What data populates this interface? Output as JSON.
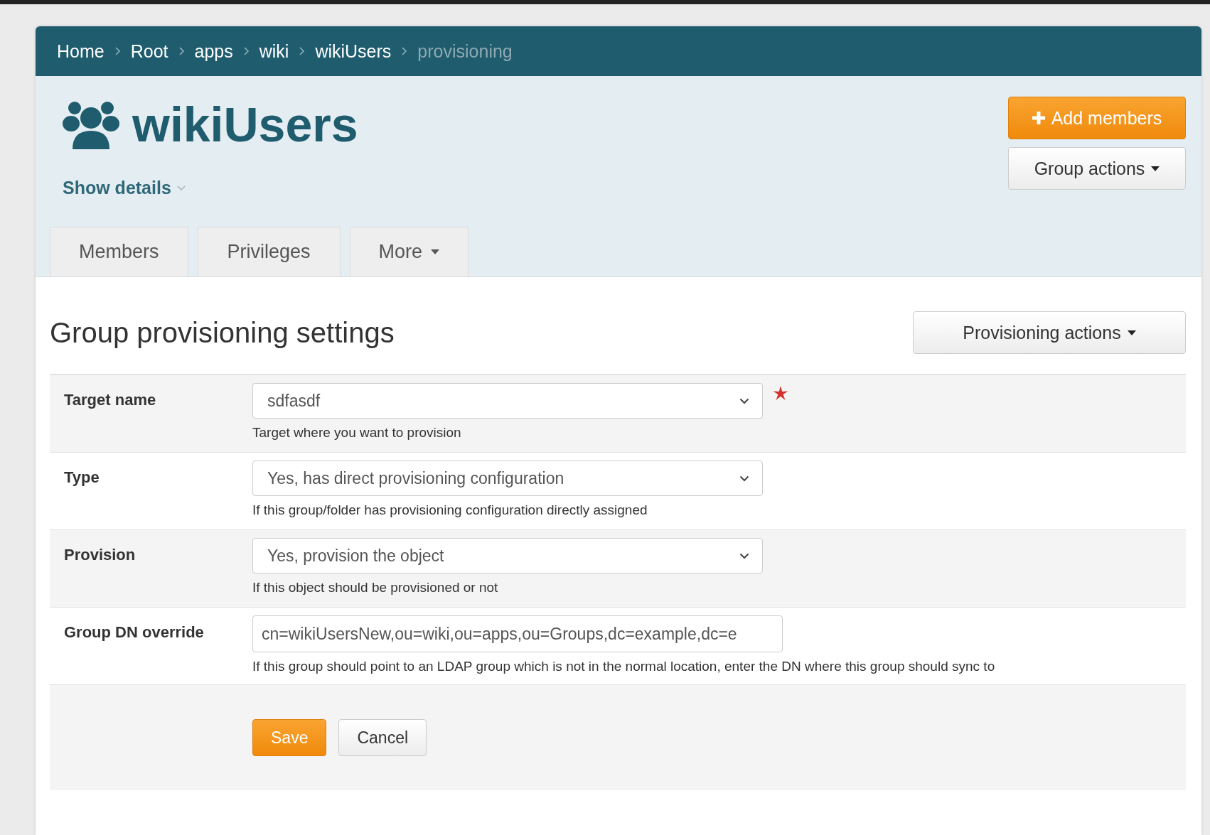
{
  "breadcrumb": [
    {
      "label": "Home",
      "current": false
    },
    {
      "label": "Root",
      "current": false
    },
    {
      "label": "apps",
      "current": false
    },
    {
      "label": "wiki",
      "current": false
    },
    {
      "label": "wikiUsers",
      "current": false
    },
    {
      "label": "provisioning",
      "current": true
    }
  ],
  "group": {
    "title": "wikiUsers",
    "details_toggle": "Show details"
  },
  "header_buttons": [
    {
      "label": "Add members",
      "kind": "primary"
    },
    {
      "label": "Group actions",
      "kind": "dropdown"
    }
  ],
  "tabs": [
    {
      "label": "Members",
      "kind": "plain"
    },
    {
      "label": "Privileges",
      "kind": "plain"
    },
    {
      "label": "More",
      "kind": "dropdown"
    }
  ],
  "section": {
    "title": "Group provisioning settings",
    "actions": "Provisioning actions"
  },
  "fields": [
    {
      "label": "Target name",
      "kind": "select",
      "value": "sdfasdf",
      "required": true,
      "help": "Target where you want to provision"
    },
    {
      "label": "Type",
      "kind": "select",
      "value": "Yes, has direct provisioning configuration",
      "required": false,
      "help": "If this group/folder has provisioning configuration directly assigned"
    },
    {
      "label": "Provision",
      "kind": "select",
      "value": "Yes, provision the object",
      "required": false,
      "help": "If this object should be provisioned or not"
    },
    {
      "label": "Group DN override",
      "kind": "text",
      "value": "cn=wikiUsersNew,ou=wiki,ou=apps,ou=Groups,dc=example,dc=e",
      "required": false,
      "help": "If this group should point to an LDAP group which is not in the normal location, enter the DN where this group should sync to"
    }
  ],
  "form_buttons": [
    {
      "label": "Save",
      "kind": "primary"
    },
    {
      "label": "Cancel",
      "kind": "default"
    }
  ]
}
